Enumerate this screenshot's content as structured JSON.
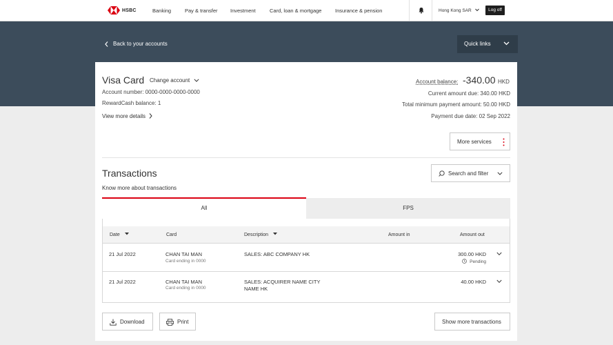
{
  "brand": {
    "name": "HSBC",
    "accent": "#db0011"
  },
  "nav": {
    "items": [
      "Banking",
      "Pay & transfer",
      "Investment",
      "Card, loan & mortgage",
      "Insurance & pension"
    ],
    "region": "Hong Kong SAR",
    "logoff": "Log off"
  },
  "banner": {
    "back_label": "Back to your accounts",
    "quick_links": "Quick links"
  },
  "account": {
    "title": "Visa Card",
    "change": "Change account",
    "number": "Account number: 0000-0000-0000-0000",
    "reward": "RewardCash balance: 1",
    "details": "View more details",
    "balance_label": "Account balance:",
    "balance_value": "-340.00",
    "balance_currency": "HKD",
    "current_due": "Current amount due: 340.00 HKD",
    "min_payment": "Total minimum payment amount: 50.00 HKD",
    "due_date": "Payment due date: 02 Sep 2022",
    "more_services": "More services"
  },
  "transactions": {
    "title": "Transactions",
    "know_more": "Know more about transactions",
    "search_filter": "Search and filter",
    "tabs": [
      "All",
      "FPS"
    ],
    "headers": {
      "date": "Date",
      "card": "Card",
      "description": "Description",
      "amount_in": "Amount in",
      "amount_out": "Amount out"
    },
    "rows": [
      {
        "date": "21 Jul 2022",
        "card": "CHAN TAI MAN",
        "card_sub": "Card ending in 0000",
        "description": "SALES: ABC COMPANY HK",
        "description2": "",
        "amount_out": "300.00 HKD",
        "status": "Pending"
      },
      {
        "date": "21 Jul 2022",
        "card": "CHAN TAI MAN",
        "card_sub": "Card ending in 0000",
        "description": "SALES: ACQUIRER NAME CITY",
        "description2": "NAME HK",
        "amount_out": "40.00 HKD",
        "status": ""
      }
    ],
    "download": "Download",
    "print": "Print",
    "show_more": "Show more transactions"
  }
}
